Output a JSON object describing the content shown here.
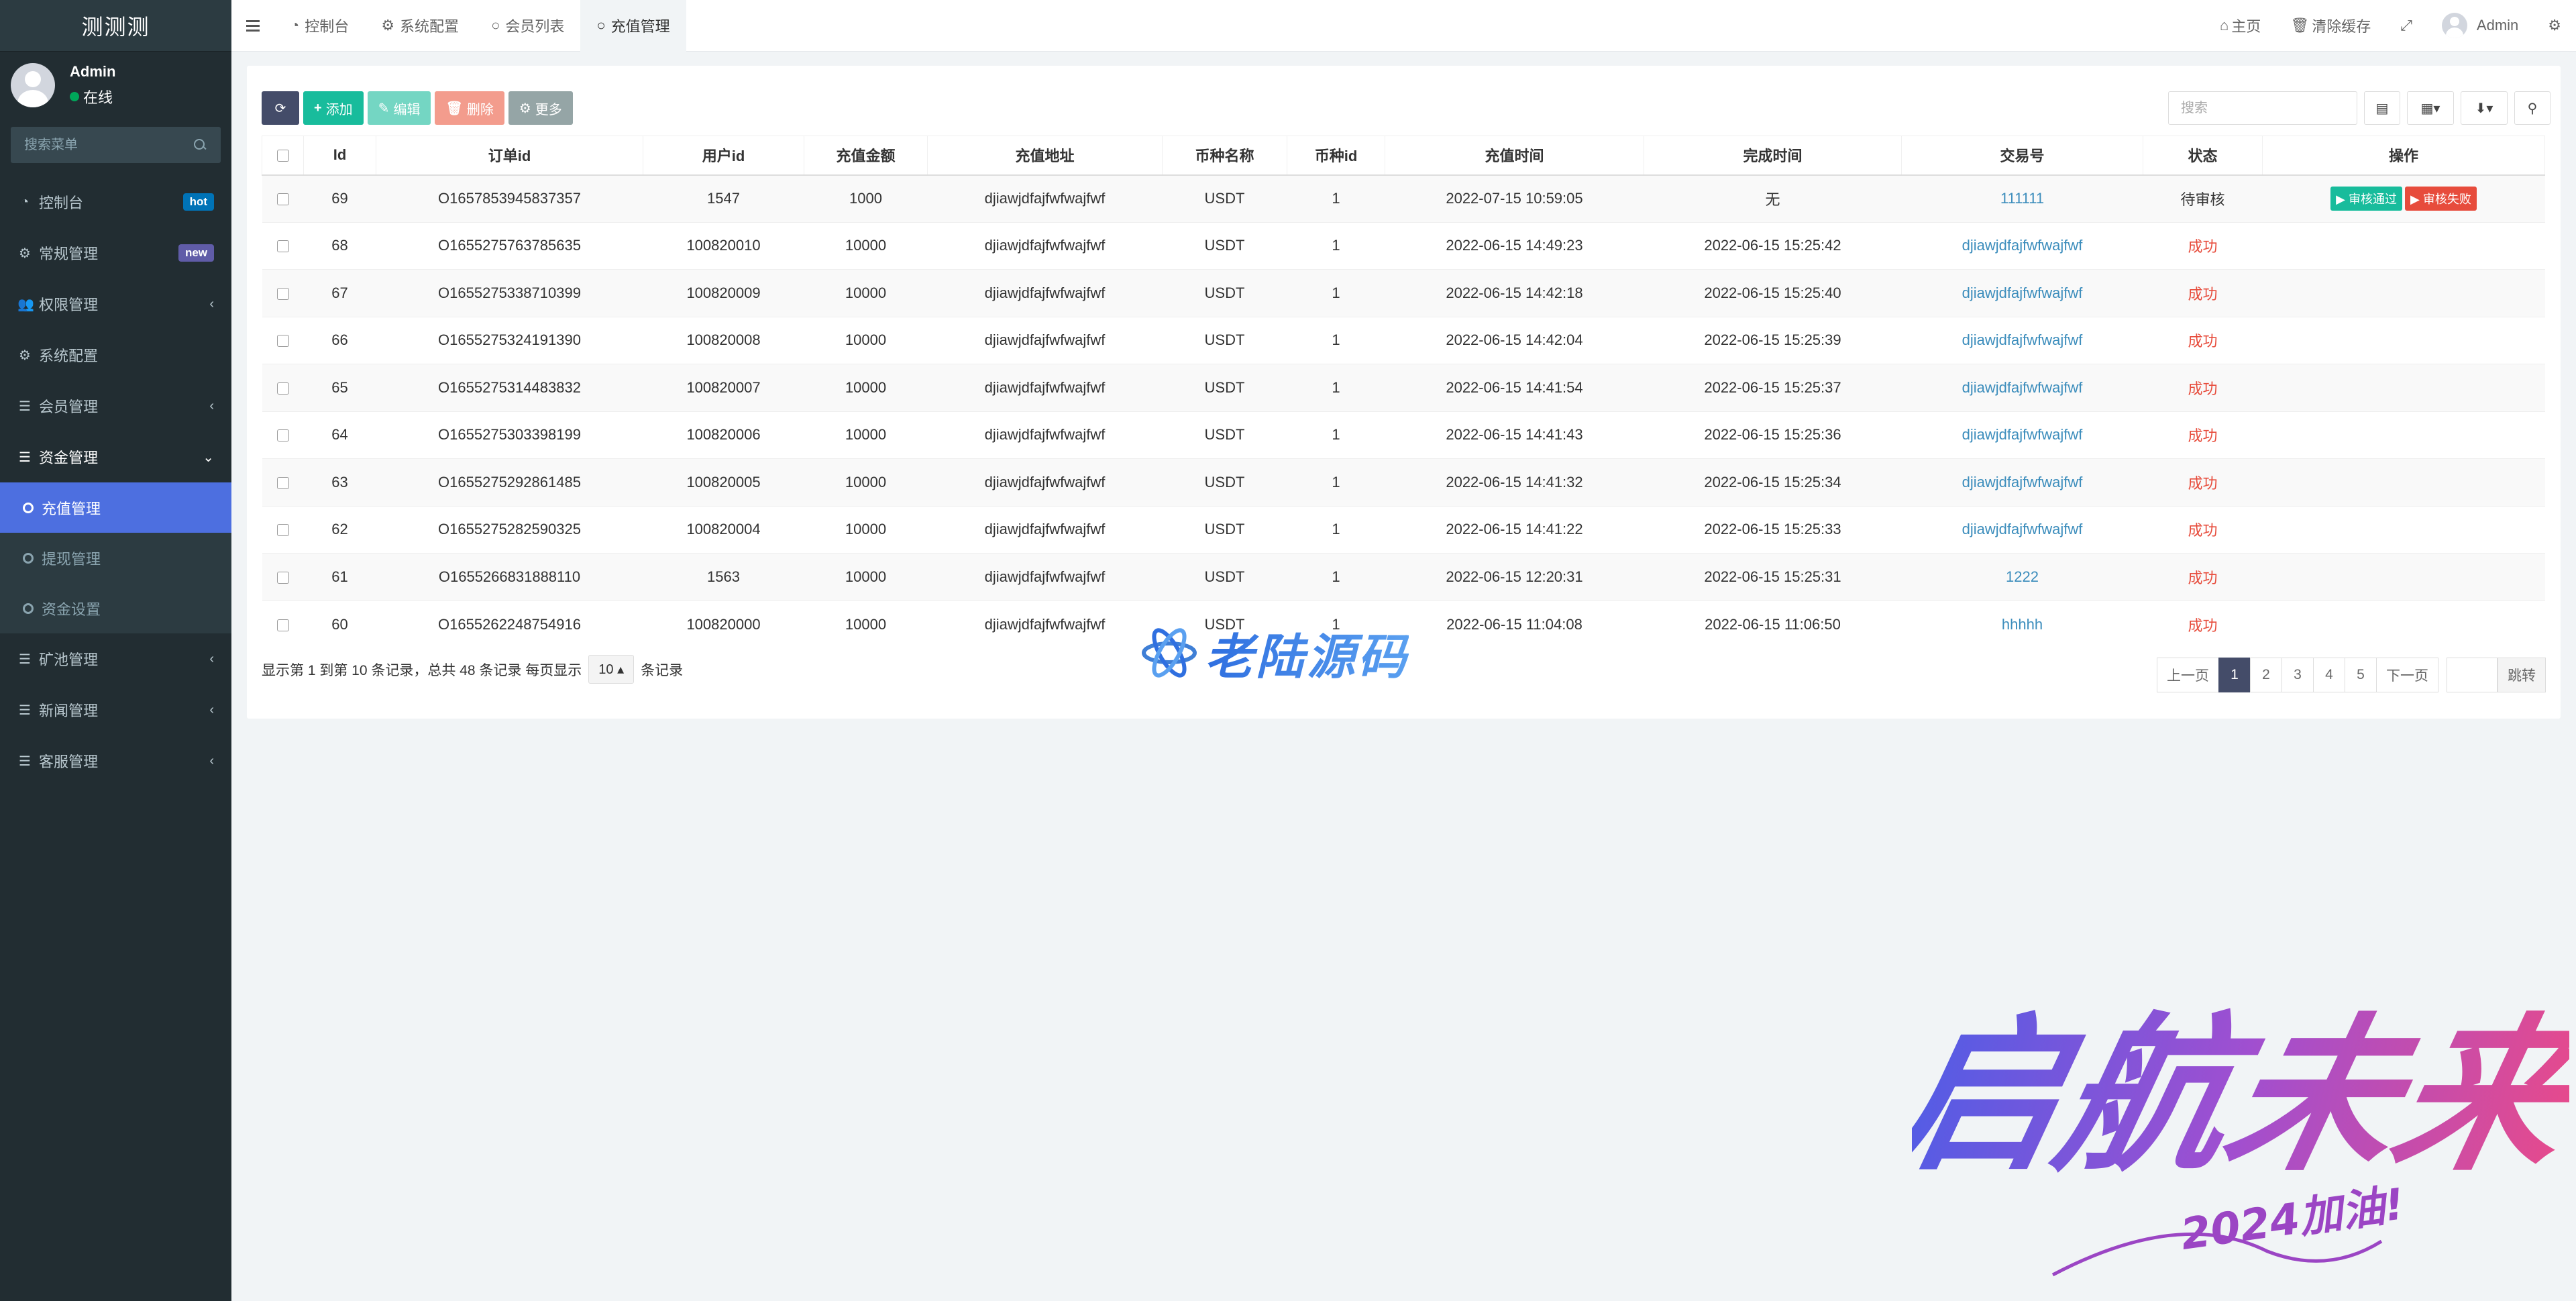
{
  "sidebar": {
    "brand": "测测测",
    "user": {
      "name": "Admin",
      "status": "在线"
    },
    "search_placeholder": "搜索菜单",
    "items": [
      {
        "label": "控制台",
        "badge": "hot",
        "icon": "dashboard-icon"
      },
      {
        "label": "常规管理",
        "badge": "new",
        "icon": "cogs-icon"
      },
      {
        "label": "权限管理",
        "icon": "users-icon"
      },
      {
        "label": "系统配置",
        "icon": "gear-icon"
      },
      {
        "label": "会员管理",
        "icon": "list-icon"
      },
      {
        "label": "资金管理",
        "icon": "list-icon"
      }
    ],
    "sub_items": [
      {
        "label": "充值管理"
      },
      {
        "label": "提现管理"
      },
      {
        "label": "资金设置"
      }
    ],
    "items_after": [
      {
        "label": "矿池管理"
      },
      {
        "label": "新闻管理"
      },
      {
        "label": "客服管理"
      }
    ]
  },
  "topbar": {
    "tabs": [
      {
        "label": "控制台"
      },
      {
        "label": "系统配置"
      },
      {
        "label": "会员列表"
      },
      {
        "label": "充值管理"
      }
    ],
    "home": "主页",
    "clear_cache": "清除缓存",
    "admin": "Admin"
  },
  "toolbar": {
    "add": "添加",
    "edit": "编辑",
    "delete": "删除",
    "more": "更多",
    "search_placeholder": "搜索"
  },
  "table": {
    "headers": [
      "Id",
      "订单id",
      "用户id",
      "充值金额",
      "充值地址",
      "币种名称",
      "币种id",
      "充值时间",
      "完成时间",
      "交易号",
      "状态",
      "操作"
    ],
    "rows": [
      [
        "69",
        "O1657853945837357",
        "1547",
        "1000",
        "djiawjdfajfwfwajfwf",
        "USDT",
        "1",
        "2022-07-15 10:59:05",
        "无",
        "111111",
        "待审核"
      ],
      [
        "68",
        "O1655275763785635",
        "100820010",
        "10000",
        "djiawjdfajfwfwajfwf",
        "USDT",
        "1",
        "2022-06-15 14:49:23",
        "2022-06-15 15:25:42",
        "djiawjdfajfwfwajfwf",
        "成功"
      ],
      [
        "67",
        "O1655275338710399",
        "100820009",
        "10000",
        "djiawjdfajfwfwajfwf",
        "USDT",
        "1",
        "2022-06-15 14:42:18",
        "2022-06-15 15:25:40",
        "djiawjdfajfwfwajfwf",
        "成功"
      ],
      [
        "66",
        "O1655275324191390",
        "100820008",
        "10000",
        "djiawjdfajfwfwajfwf",
        "USDT",
        "1",
        "2022-06-15 14:42:04",
        "2022-06-15 15:25:39",
        "djiawjdfajfwfwajfwf",
        "成功"
      ],
      [
        "65",
        "O1655275314483832",
        "100820007",
        "10000",
        "djiawjdfajfwfwajfwf",
        "USDT",
        "1",
        "2022-06-15 14:41:54",
        "2022-06-15 15:25:37",
        "djiawjdfajfwfwajfwf",
        "成功"
      ],
      [
        "64",
        "O1655275303398199",
        "100820006",
        "10000",
        "djiawjdfajfwfwajfwf",
        "USDT",
        "1",
        "2022-06-15 14:41:43",
        "2022-06-15 15:25:36",
        "djiawjdfajfwfwajfwf",
        "成功"
      ],
      [
        "63",
        "O1655275292861485",
        "100820005",
        "10000",
        "djiawjdfajfwfwajfwf",
        "USDT",
        "1",
        "2022-06-15 14:41:32",
        "2022-06-15 15:25:34",
        "djiawjdfajfwfwajfwf",
        "成功"
      ],
      [
        "62",
        "O1655275282590325",
        "100820004",
        "10000",
        "djiawjdfajfwfwajfwf",
        "USDT",
        "1",
        "2022-06-15 14:41:22",
        "2022-06-15 15:25:33",
        "djiawjdfajfwfwajfwf",
        "成功"
      ],
      [
        "61",
        "O1655266831888110",
        "1563",
        "10000",
        "djiawjdfajfwfwajfwf",
        "USDT",
        "1",
        "2022-06-15 12:20:31",
        "2022-06-15 15:25:31",
        "1222",
        "成功"
      ],
      [
        "60",
        "O1655262248754916",
        "100820000",
        "10000",
        "djiawjdfajfwfwajfwf",
        "USDT",
        "1",
        "2022-06-15 11:04:08",
        "2022-06-15 11:06:50",
        "hhhhh",
        "成功"
      ]
    ],
    "action_pass": "审核通过",
    "action_fail": "审核失败"
  },
  "pager": {
    "info_prefix": "显示第 1 到第 10 条记录，总共 48 条记录 每页显示",
    "page_size": "10",
    "info_suffix": "条记录",
    "prev": "上一页",
    "pages": [
      "1",
      "2",
      "3",
      "4",
      "5"
    ],
    "next": "下一页",
    "jump": "跳转"
  },
  "watermark": {
    "center": "老陆源码",
    "art_main": "启航未来",
    "art_sub": "2024加油!"
  },
  "colors": {
    "sidebar_bg": "#222d32",
    "active_sub": "#4d6fe0",
    "primary_dark": "#444c69",
    "success": "#18bc9c",
    "danger": "#e74c3c",
    "link": "#3c8dbc"
  }
}
